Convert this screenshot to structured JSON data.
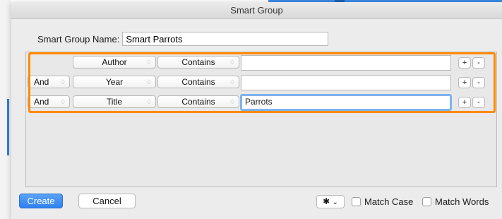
{
  "dialog": {
    "title": "Smart Group",
    "name_label": "Smart Group Name:",
    "name_value": "Smart Parrots"
  },
  "rules": [
    {
      "conjunction": "",
      "field": "Author",
      "operator": "Contains",
      "value": ""
    },
    {
      "conjunction": "And",
      "field": "Year",
      "operator": "Contains",
      "value": ""
    },
    {
      "conjunction": "And",
      "field": "Title",
      "operator": "Contains",
      "value": "Parrots"
    }
  ],
  "row_buttons": {
    "add": "+",
    "remove": "-"
  },
  "popup_arrows": "♢",
  "footer": {
    "create": "Create",
    "cancel": "Cancel",
    "gear_icon": "✱",
    "gear_chevron": "⌄",
    "match_case": "Match Case",
    "match_words": "Match Words"
  },
  "colors": {
    "accent": "#2f80ee",
    "highlight": "#ff8a00",
    "focus_ring": "#7fb3ee"
  }
}
